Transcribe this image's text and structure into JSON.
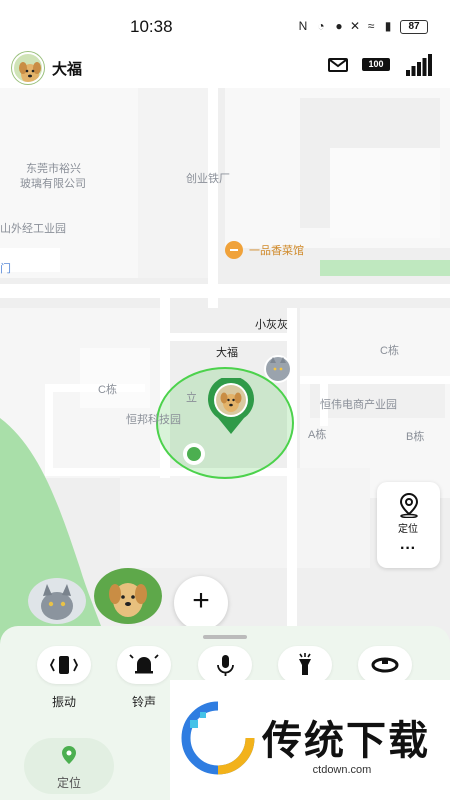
{
  "status_bar": {
    "time": "10:38",
    "battery": "87"
  },
  "header": {
    "pet_name": "大福",
    "device_battery": "100"
  },
  "map": {
    "labels": {
      "glass_company_line1": "东莞市裕兴",
      "glass_company_line2": "玻璃有限公司",
      "iron_factory": "创业铁厂",
      "industrial_park": "山外经工业园",
      "gate": "门",
      "restaurant": "一品香菜馆",
      "c_building_left": "C栋",
      "c_building_right": "C栋",
      "tech_park": "恒邦科技园",
      "li": "立",
      "ecommerce_park": "恒伟电商产业园",
      "a_building": "A栋",
      "b_building": "B栋",
      "pet_xiaohuihui": "小灰灰",
      "pet_dafu": "大福"
    }
  },
  "side_controls": {
    "locate_label": "定位",
    "more_label": "···"
  },
  "add_pet_label": "+",
  "actions": [
    {
      "label": "振动",
      "icon": "vibrate-icon"
    },
    {
      "label": "铃声",
      "icon": "bell-icon"
    },
    {
      "label": "",
      "icon": "microphone-icon"
    },
    {
      "label": "",
      "icon": "flashlight-icon"
    },
    {
      "label": "",
      "icon": "collar-icon"
    }
  ],
  "bottom_tab": {
    "label": "定位"
  },
  "watermark": {
    "text": "传统下载",
    "url": "ctdown.com"
  },
  "colors": {
    "accent_green": "#2f9a48",
    "range_circle": "#55cc55"
  }
}
